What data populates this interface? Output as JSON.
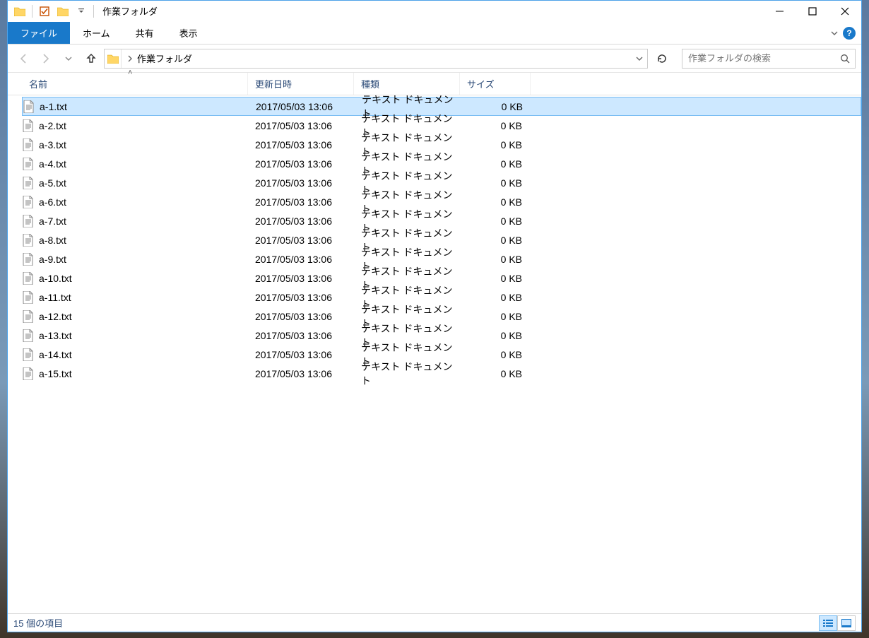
{
  "window": {
    "title": "作業フォルダ"
  },
  "ribbon": {
    "tabs": {
      "file": "ファイル",
      "home": "ホーム",
      "share": "共有",
      "view": "表示"
    }
  },
  "breadcrumb": {
    "segments": [
      "作業フォルダ"
    ],
    "separator": "›"
  },
  "search": {
    "placeholder": "作業フォルダの検索"
  },
  "columns": {
    "name": "名前",
    "date": "更新日時",
    "type": "種類",
    "size": "サイズ"
  },
  "files": [
    {
      "name": "a-1.txt",
      "date": "2017/05/03 13:06",
      "type": "テキスト ドキュメント",
      "size": "0 KB",
      "selected": true
    },
    {
      "name": "a-2.txt",
      "date": "2017/05/03 13:06",
      "type": "テキスト ドキュメント",
      "size": "0 KB",
      "selected": false
    },
    {
      "name": "a-3.txt",
      "date": "2017/05/03 13:06",
      "type": "テキスト ドキュメント",
      "size": "0 KB",
      "selected": false
    },
    {
      "name": "a-4.txt",
      "date": "2017/05/03 13:06",
      "type": "テキスト ドキュメント",
      "size": "0 KB",
      "selected": false
    },
    {
      "name": "a-5.txt",
      "date": "2017/05/03 13:06",
      "type": "テキスト ドキュメント",
      "size": "0 KB",
      "selected": false
    },
    {
      "name": "a-6.txt",
      "date": "2017/05/03 13:06",
      "type": "テキスト ドキュメント",
      "size": "0 KB",
      "selected": false
    },
    {
      "name": "a-7.txt",
      "date": "2017/05/03 13:06",
      "type": "テキスト ドキュメント",
      "size": "0 KB",
      "selected": false
    },
    {
      "name": "a-8.txt",
      "date": "2017/05/03 13:06",
      "type": "テキスト ドキュメント",
      "size": "0 KB",
      "selected": false
    },
    {
      "name": "a-9.txt",
      "date": "2017/05/03 13:06",
      "type": "テキスト ドキュメント",
      "size": "0 KB",
      "selected": false
    },
    {
      "name": "a-10.txt",
      "date": "2017/05/03 13:06",
      "type": "テキスト ドキュメント",
      "size": "0 KB",
      "selected": false
    },
    {
      "name": "a-11.txt",
      "date": "2017/05/03 13:06",
      "type": "テキスト ドキュメント",
      "size": "0 KB",
      "selected": false
    },
    {
      "name": "a-12.txt",
      "date": "2017/05/03 13:06",
      "type": "テキスト ドキュメント",
      "size": "0 KB",
      "selected": false
    },
    {
      "name": "a-13.txt",
      "date": "2017/05/03 13:06",
      "type": "テキスト ドキュメント",
      "size": "0 KB",
      "selected": false
    },
    {
      "name": "a-14.txt",
      "date": "2017/05/03 13:06",
      "type": "テキスト ドキュメント",
      "size": "0 KB",
      "selected": false
    },
    {
      "name": "a-15.txt",
      "date": "2017/05/03 13:06",
      "type": "テキスト ドキュメント",
      "size": "0 KB",
      "selected": false
    }
  ],
  "status": {
    "item_count": "15 個の項目"
  }
}
